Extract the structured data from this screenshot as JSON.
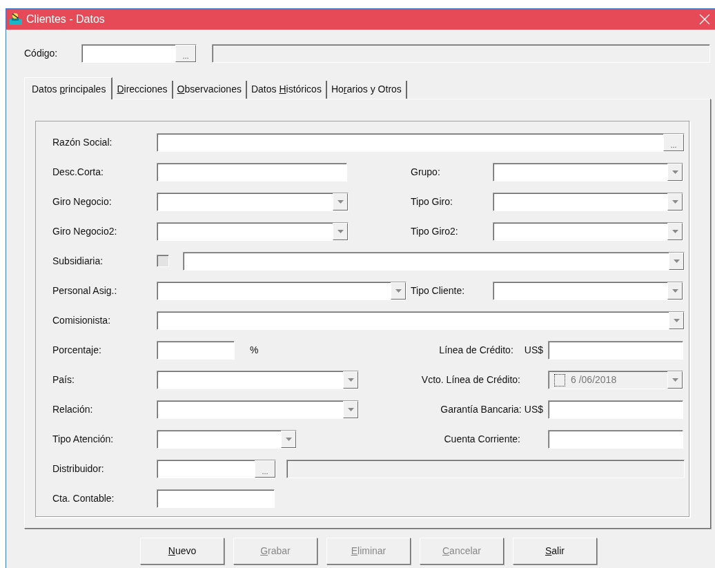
{
  "window": {
    "title": "Clientes - Datos"
  },
  "codigo": {
    "label": "Código:",
    "button": "..."
  },
  "tabs": [
    {
      "before": "Datos ",
      "access_key": "p",
      "after": "rincipales",
      "selected": true
    },
    {
      "access_key": "D",
      "after": "irecciones",
      "selected": false
    },
    {
      "access_key": "O",
      "after": "bservaciones",
      "selected": false
    },
    {
      "before": "Datos ",
      "access_key": "H",
      "after": "istóricos",
      "selected": false
    },
    {
      "before": "Ho",
      "access_key": "r",
      "after": "arios y Otros",
      "selected": false
    }
  ],
  "rows": [
    {
      "label": "Razón Social:",
      "fields": [
        {
          "kind": "lookup",
          "button": "..."
        }
      ]
    },
    {
      "label": "Desc.Corta:",
      "fields": [
        {
          "kind": "text"
        }
      ],
      "right": {
        "label": "Grupo:",
        "field": {
          "kind": "combo"
        }
      }
    },
    {
      "label": "Giro Negocio:",
      "fields": [
        {
          "kind": "combo"
        }
      ],
      "right": {
        "label": "Tipo Giro:",
        "field": {
          "kind": "combo"
        }
      }
    },
    {
      "label": "Giro Negocio2:",
      "fields": [
        {
          "kind": "combo"
        }
      ],
      "right": {
        "label": "Tipo Giro2:",
        "field": {
          "kind": "combo"
        }
      }
    },
    {
      "label": "Subsidiaria:",
      "fields": [
        {
          "kind": "checkbox",
          "checked": false
        },
        {
          "kind": "combo"
        }
      ]
    },
    {
      "label": "Personal Asig.:",
      "fields": [
        {
          "kind": "combo"
        }
      ],
      "right": {
        "label": "Tipo Cliente:",
        "field": {
          "kind": "combo"
        }
      }
    },
    {
      "label": "Comisionista:",
      "fields": [
        {
          "kind": "combo"
        }
      ]
    },
    {
      "label": "Porcentaje:",
      "fields": [
        {
          "kind": "text"
        },
        {
          "kind": "unit",
          "text": "%"
        }
      ],
      "right": {
        "label": "Línea de Crédito:",
        "unit": "US$",
        "field": {
          "kind": "text"
        }
      }
    },
    {
      "label": "País:",
      "fields": [
        {
          "kind": "combo"
        }
      ],
      "right": {
        "label": "Vcto. Línea de Crédito:",
        "field": {
          "kind": "date",
          "checked": false,
          "value": "6 /06/2018",
          "disabled": true
        }
      }
    },
    {
      "label": "Relación:",
      "fields": [
        {
          "kind": "combo"
        }
      ],
      "right": {
        "label": "Garantía Bancaria:",
        "unit": "US$",
        "field": {
          "kind": "text"
        }
      }
    },
    {
      "label": "Tipo Atención:",
      "fields": [
        {
          "kind": "combo"
        }
      ],
      "right": {
        "label": "Cuenta Corriente:",
        "field": {
          "kind": "text"
        }
      }
    },
    {
      "label": "Distribuidor:",
      "fields": [
        {
          "kind": "lookup",
          "button": "..."
        },
        {
          "kind": "readonly"
        }
      ]
    },
    {
      "label": "Cta. Contable:",
      "fields": [
        {
          "kind": "text"
        }
      ]
    }
  ],
  "buttons": [
    {
      "access_key": "N",
      "after": "uevo",
      "disabled": false
    },
    {
      "access_key": "G",
      "after": "rabar",
      "disabled": true
    },
    {
      "access_key": "E",
      "after": "liminar",
      "disabled": true
    },
    {
      "access_key": "C",
      "after": "ancelar",
      "disabled": true
    },
    {
      "access_key": "S",
      "after": "alir",
      "disabled": false
    }
  ]
}
